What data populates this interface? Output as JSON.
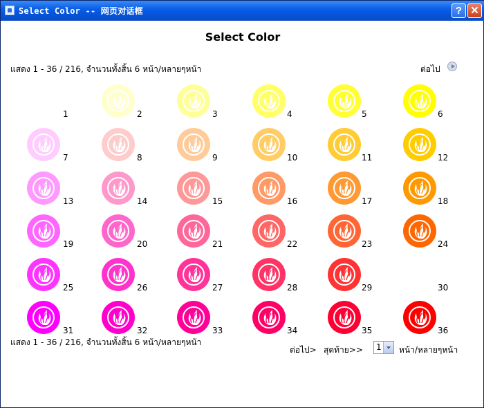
{
  "window": {
    "title": "Select Color -- 网页对话框",
    "help_label": "?",
    "close_label": "✕"
  },
  "page": {
    "heading": "Select Color"
  },
  "paging": {
    "info_top": "แสดง 1 - 36 / 216, จำนวนทั้งสิ้น 6 หน้า/หลายๆหน้า",
    "info_bottom": "แสดง 1 - 36 / 216, จำนวนทั้งสิ้น 6 หน้า/หลายๆหน้า",
    "next_label": "ต่อไป",
    "next_small": "ต่อไป>",
    "last_label": "สุดท้าย>>",
    "page_value": "1",
    "page_suffix": "หน้า/หลายๆหน้า"
  },
  "icons": {
    "swatch_icon": "flame-leaf-icon",
    "next_icon": "play-circle-icon",
    "dropdown_icon": "chevron-down-icon"
  },
  "colors": [
    {
      "num": "1",
      "hex": "#FFFFFF"
    },
    {
      "num": "2",
      "hex": "#FFFFCC"
    },
    {
      "num": "3",
      "hex": "#FFFF99"
    },
    {
      "num": "4",
      "hex": "#FFFF66"
    },
    {
      "num": "5",
      "hex": "#FFFF33"
    },
    {
      "num": "6",
      "hex": "#FFFF00"
    },
    {
      "num": "7",
      "hex": "#FFCCFF"
    },
    {
      "num": "8",
      "hex": "#FFCCCC"
    },
    {
      "num": "9",
      "hex": "#FFCC99"
    },
    {
      "num": "10",
      "hex": "#FFCC66"
    },
    {
      "num": "11",
      "hex": "#FFCC33"
    },
    {
      "num": "12",
      "hex": "#FFCC00"
    },
    {
      "num": "13",
      "hex": "#FF99FF"
    },
    {
      "num": "14",
      "hex": "#FF99CC"
    },
    {
      "num": "15",
      "hex": "#FF9999"
    },
    {
      "num": "16",
      "hex": "#FF9966"
    },
    {
      "num": "17",
      "hex": "#FF9933"
    },
    {
      "num": "18",
      "hex": "#FF9900"
    },
    {
      "num": "19",
      "hex": "#FF66FF"
    },
    {
      "num": "20",
      "hex": "#FF66CC"
    },
    {
      "num": "21",
      "hex": "#FF6699"
    },
    {
      "num": "22",
      "hex": "#FF6666"
    },
    {
      "num": "23",
      "hex": "#FF6633"
    },
    {
      "num": "24",
      "hex": "#FF6600"
    },
    {
      "num": "25",
      "hex": "#FF33FF"
    },
    {
      "num": "26",
      "hex": "#FF33CC"
    },
    {
      "num": "27",
      "hex": "#FF3399"
    },
    {
      "num": "28",
      "hex": "#FF3366"
    },
    {
      "num": "29",
      "hex": "#FF3333"
    },
    {
      "num": "30",
      "hex": "#FF3300"
    },
    {
      "num": "31",
      "hex": "#FF00FF"
    },
    {
      "num": "32",
      "hex": "#FF00CC"
    },
    {
      "num": "33",
      "hex": "#FF0099"
    },
    {
      "num": "34",
      "hex": "#FF0066"
    },
    {
      "num": "35",
      "hex": "#FF0033"
    },
    {
      "num": "36",
      "hex": "#FF0000"
    }
  ]
}
